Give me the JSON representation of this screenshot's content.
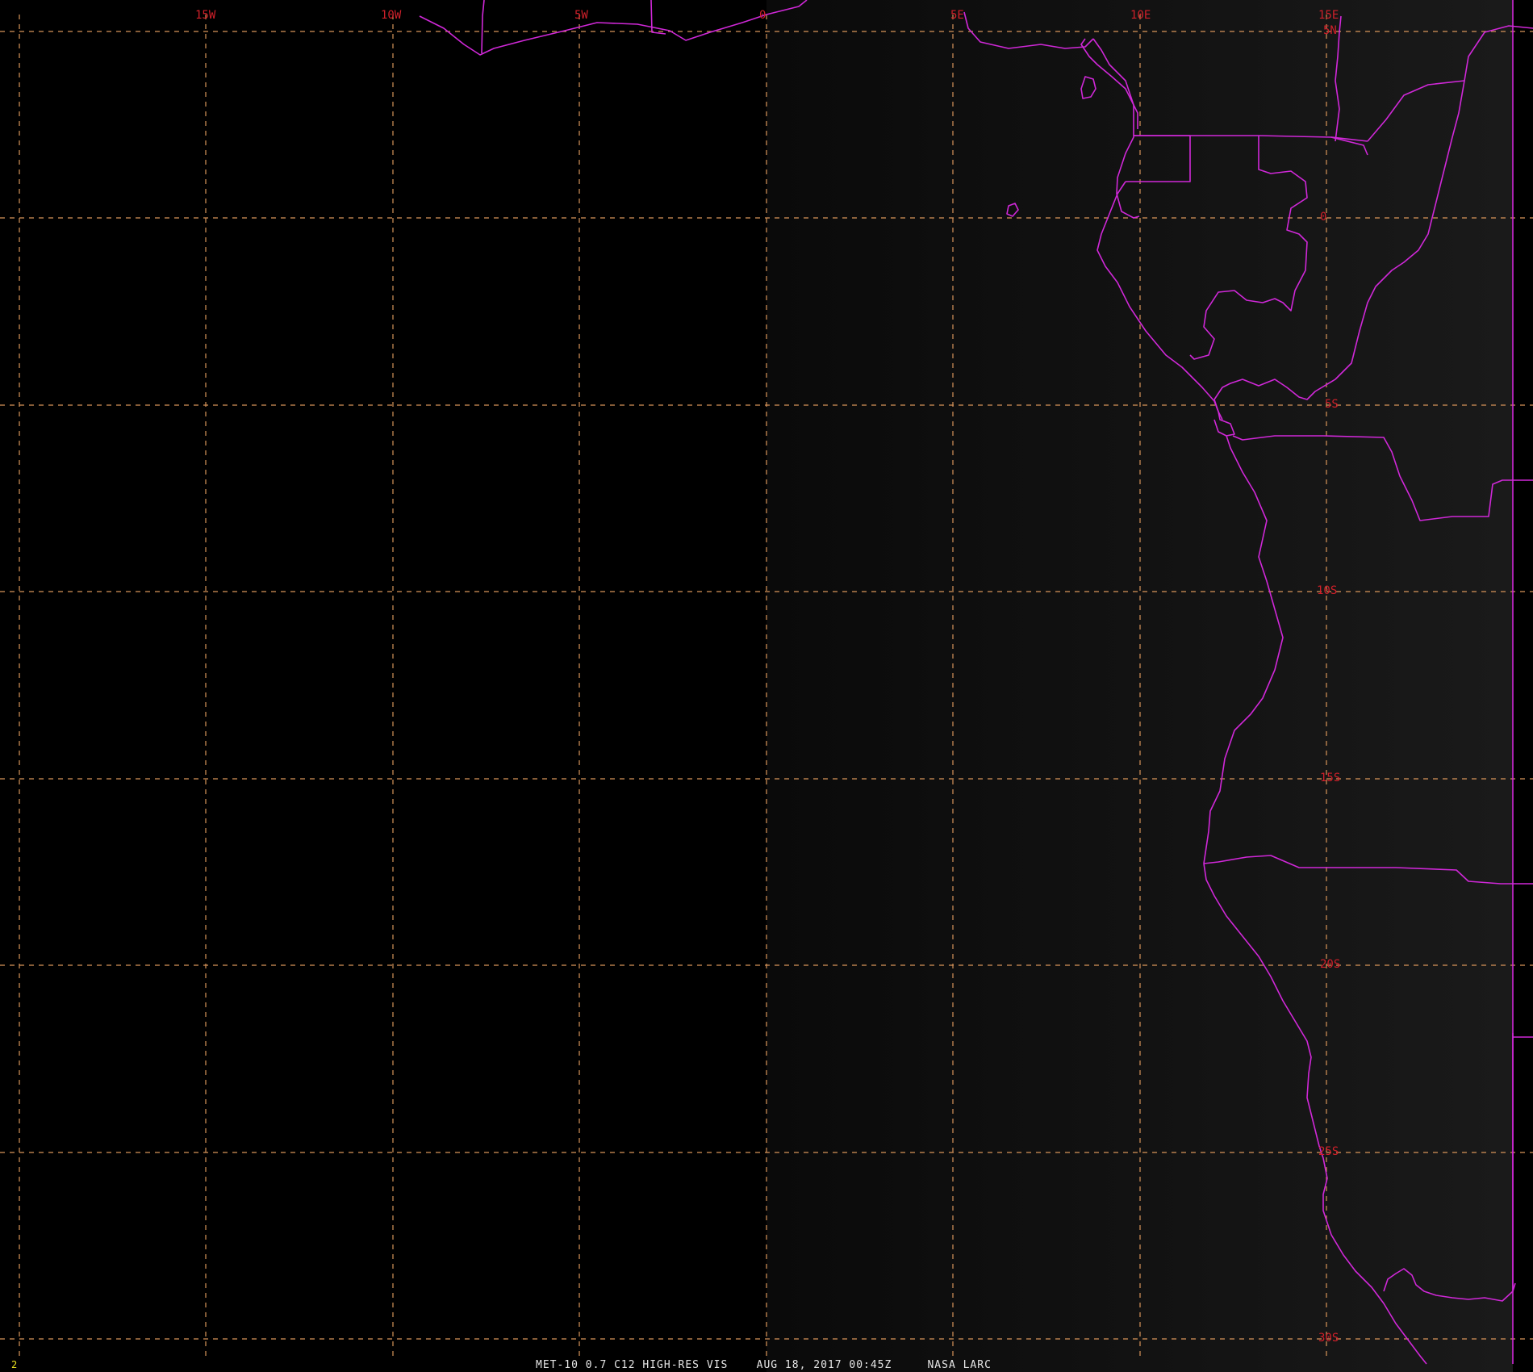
{
  "image": {
    "frame_number": "2",
    "caption": "MET-10 0.7 C12 HIGH-RES VIS    AUG 18, 2017 00:45Z     NASA LARC"
  },
  "colors": {
    "background_west": "#000000",
    "background_east": "#161616",
    "grid_lines": "#d8955a",
    "grid_labels": "#d0202a",
    "boundaries": "#d028d8",
    "caption_text": "#e6e6e6",
    "frame_number_text": "#e8e020"
  },
  "longitude_labels": [
    "15W",
    "10W",
    "5W",
    "0",
    "5E",
    "10E",
    "15E"
  ],
  "latitude_labels": [
    "5N",
    "0",
    "5S",
    "10S",
    "15S",
    "20S",
    "25S",
    "30S"
  ]
}
